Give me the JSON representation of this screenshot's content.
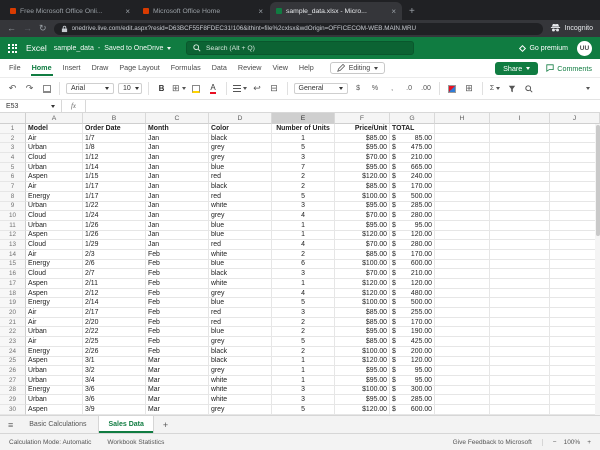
{
  "browser": {
    "tabs": [
      {
        "title": "Free Microsoft Office Onli...",
        "favicon_color": "#d83b01"
      },
      {
        "title": "Microsoft Office Home",
        "favicon_color": "#d83b01"
      },
      {
        "title": "sample_data.xlsx - Micro...",
        "favicon_color": "#107c41"
      }
    ],
    "url": "onedrive.live.com/edit.aspx?resid=D63BCF55F8FDEC31!106&ithint=file%2cxlsx&wdOrigin=OFFICECOM-WEB.MAIN.MRU",
    "incognito_label": "Incognito"
  },
  "header": {
    "app_name": "Excel",
    "doc_title": "sample_data",
    "doc_separator": "-",
    "doc_status": "Saved to OneDrive",
    "search_placeholder": "Search (Alt + Q)",
    "premium_label": "Go premium",
    "avatar_initials": "UU"
  },
  "ribbon": {
    "tabs": [
      "File",
      "Home",
      "Insert",
      "Draw",
      "Page Layout",
      "Formulas",
      "Data",
      "Review",
      "View",
      "Help"
    ],
    "active_tab": "Home",
    "editing_label": "Editing",
    "share_label": "Share",
    "comments_label": "Comments"
  },
  "toolbar": {
    "font_name": "Arial",
    "font_size": "10",
    "bold_label": "B",
    "font_color_label": "A",
    "number_format": "General",
    "currency_label": "$",
    "percent_label": "%",
    "comma_label": ",",
    "decimal_decrease": ".0",
    "decimal_increase": ".00",
    "sum_label": "Σ"
  },
  "formula_bar": {
    "cell_ref": "E53",
    "fx_label": "fx",
    "formula_value": ""
  },
  "grid": {
    "column_letters": [
      "A",
      "B",
      "C",
      "D",
      "E",
      "F",
      "G",
      "H",
      "I",
      "J"
    ],
    "selected_column": "E",
    "header_row": [
      "Model",
      "Order Date",
      "Month",
      "Color",
      "Number of Units",
      "Price/Unit",
      "TOTAL"
    ],
    "rows": [
      [
        "Air",
        "1/7",
        "Jan",
        "black",
        "1",
        "$85.00",
        "$ 85.00"
      ],
      [
        "Urban",
        "1/8",
        "Jan",
        "grey",
        "5",
        "$95.00",
        "$ 475.00"
      ],
      [
        "Cloud",
        "1/12",
        "Jan",
        "grey",
        "3",
        "$70.00",
        "$ 210.00"
      ],
      [
        "Urban",
        "1/14",
        "Jan",
        "blue",
        "7",
        "$95.00",
        "$ 665.00"
      ],
      [
        "Aspen",
        "1/15",
        "Jan",
        "red",
        "2",
        "$120.00",
        "$ 240.00"
      ],
      [
        "Air",
        "1/17",
        "Jan",
        "black",
        "2",
        "$85.00",
        "$ 170.00"
      ],
      [
        "Energy",
        "1/17",
        "Jan",
        "red",
        "5",
        "$100.00",
        "$ 500.00"
      ],
      [
        "Urban",
        "1/22",
        "Jan",
        "white",
        "3",
        "$95.00",
        "$ 285.00"
      ],
      [
        "Cloud",
        "1/24",
        "Jan",
        "grey",
        "4",
        "$70.00",
        "$ 280.00"
      ],
      [
        "Urban",
        "1/26",
        "Jan",
        "blue",
        "1",
        "$95.00",
        "$ 95.00"
      ],
      [
        "Aspen",
        "1/26",
        "Jan",
        "blue",
        "1",
        "$120.00",
        "$ 120.00"
      ],
      [
        "Cloud",
        "1/29",
        "Jan",
        "red",
        "4",
        "$70.00",
        "$ 280.00"
      ],
      [
        "Air",
        "2/3",
        "Feb",
        "white",
        "2",
        "$85.00",
        "$ 170.00"
      ],
      [
        "Energy",
        "2/6",
        "Feb",
        "blue",
        "6",
        "$100.00",
        "$ 600.00"
      ],
      [
        "Cloud",
        "2/7",
        "Feb",
        "black",
        "3",
        "$70.00",
        "$ 210.00"
      ],
      [
        "Aspen",
        "2/11",
        "Feb",
        "white",
        "1",
        "$120.00",
        "$ 120.00"
      ],
      [
        "Aspen",
        "2/12",
        "Feb",
        "grey",
        "4",
        "$120.00",
        "$ 480.00"
      ],
      [
        "Energy",
        "2/14",
        "Feb",
        "blue",
        "5",
        "$100.00",
        "$ 500.00"
      ],
      [
        "Air",
        "2/17",
        "Feb",
        "red",
        "3",
        "$85.00",
        "$ 255.00"
      ],
      [
        "Air",
        "2/20",
        "Feb",
        "red",
        "2",
        "$85.00",
        "$ 170.00"
      ],
      [
        "Urban",
        "2/22",
        "Feb",
        "blue",
        "2",
        "$95.00",
        "$ 190.00"
      ],
      [
        "Air",
        "2/25",
        "Feb",
        "grey",
        "5",
        "$85.00",
        "$ 425.00"
      ],
      [
        "Energy",
        "2/26",
        "Feb",
        "black",
        "2",
        "$100.00",
        "$ 200.00"
      ],
      [
        "Aspen",
        "3/1",
        "Mar",
        "black",
        "1",
        "$120.00",
        "$ 120.00"
      ],
      [
        "Urban",
        "3/2",
        "Mar",
        "grey",
        "1",
        "$95.00",
        "$ 95.00"
      ],
      [
        "Urban",
        "3/4",
        "Mar",
        "white",
        "1",
        "$95.00",
        "$ 95.00"
      ],
      [
        "Energy",
        "3/6",
        "Mar",
        "white",
        "3",
        "$100.00",
        "$ 300.00"
      ],
      [
        "Urban",
        "3/6",
        "Mar",
        "white",
        "3",
        "$95.00",
        "$ 285.00"
      ],
      [
        "Aspen",
        "3/9",
        "Mar",
        "grey",
        "5",
        "$120.00",
        "$ 600.00"
      ]
    ]
  },
  "sheet_bar": {
    "tabs": [
      "Basic Calculations",
      "Sales Data"
    ],
    "active_tab": "Sales Data",
    "add_label": "+"
  },
  "status_bar": {
    "calc_mode": "Calculation Mode: Automatic",
    "workbook_stats": "Workbook Statistics",
    "feedback": "Give Feedback to Microsoft",
    "zoom_out": "−",
    "zoom": "100%",
    "zoom_in": "+"
  },
  "colors": {
    "excel_green": "#107c41",
    "chrome_dark": "#202124",
    "chrome_toolbar": "#35363a",
    "font_color_accent": "#e81123",
    "fill_color_accent": "#ffd400"
  }
}
